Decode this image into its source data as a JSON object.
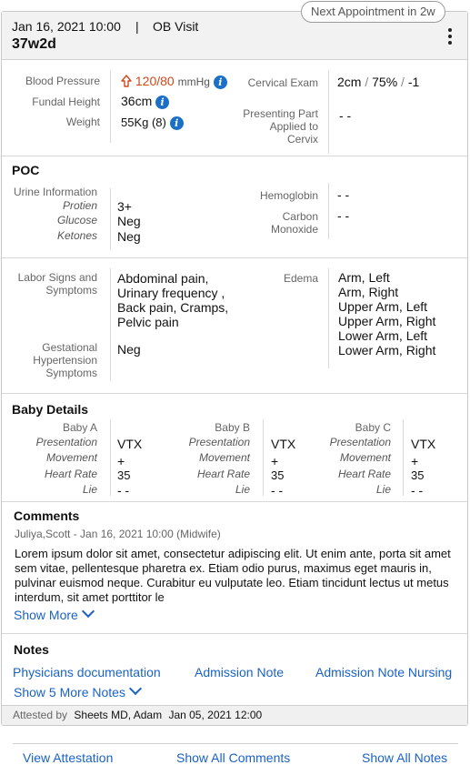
{
  "header": {
    "next_appointment": "Next Appointment in 2w",
    "date": "Jan 16, 2021 10:00",
    "separator": "|",
    "visit_type": "OB Visit",
    "gestational_age": "37w2d"
  },
  "vitals": {
    "blood_pressure_label": "Blood Pressure",
    "blood_pressure_value": "120/80",
    "blood_pressure_unit": "mmHg",
    "fundal_height_label": "Fundal Height",
    "fundal_height_value": "36cm",
    "weight_label": "Weight",
    "weight_value": "55Kg (8)",
    "cervical_exam_label": "Cervical Exam",
    "cervical_exam_dilation": "2cm",
    "cervical_exam_effacement": "75%",
    "cervical_exam_station": "-1",
    "slash": "/",
    "presenting_part_label": "Presenting Part Applied to Cervix",
    "presenting_part_value": "- -",
    "alert_color": "#d0481b"
  },
  "poc": {
    "title": "POC",
    "urine_label": "Urine Information",
    "protein_label": "Protien",
    "protein_value": "3+",
    "glucose_label": "Glucose",
    "glucose_value": "Neg",
    "ketones_label": "Ketones",
    "ketones_value": "Neg",
    "hemoglobin_label": "Hemoglobin",
    "hemoglobin_value": "- -",
    "co_label": "Carbon Monoxide",
    "co_value": "- -"
  },
  "labor": {
    "labor_label": "Labor Signs and Symptoms",
    "labor_values": [
      "Abdominal pain,",
      "Urinary frequency ,",
      "Back pain, Cramps,",
      "Pelvic pain"
    ],
    "gh_label": "Gestational Hypertension Symptoms",
    "gh_value": "Neg",
    "edema_label": "Edema",
    "edema_values": [
      "Arm, Left",
      "Arm, Right",
      "Upper Arm, Left",
      "Upper Arm, Right",
      "Lower Arm, Left",
      "Lower Arm, Right"
    ]
  },
  "baby": {
    "title": "Baby Details",
    "presentation_label": "Presentation",
    "movement_label": "Movement",
    "heart_rate_label": "Heart Rate",
    "lie_label": "Lie",
    "babies": [
      {
        "name": "Baby A",
        "presentation": "VTX",
        "movement": "+",
        "heart_rate": "35",
        "lie": "- -"
      },
      {
        "name": "Baby B",
        "presentation": "VTX",
        "movement": "+",
        "heart_rate": "35",
        "lie": "- -"
      },
      {
        "name": "Baby C",
        "presentation": "VTX",
        "movement": "+",
        "heart_rate": "35",
        "lie": "- -"
      }
    ]
  },
  "comments": {
    "title": "Comments",
    "author_meta": "Juliya,Scott - Jan 16, 2021 10:00 (Midwife)",
    "text": "Lorem ipsum dolor sit amet, consectetur adipiscing elit. Ut enim ante, porta sit amet sem vitae, pellentesque pharetra ex. Etiam odio purus, maximus eget mauris in, pulvinar euismod neque. Curabitur eu vulputate leo. Etiam tincidunt lectus ut metus interdum, sit amet porttitor le",
    "show_more": "Show More"
  },
  "notes": {
    "title": "Notes",
    "links": [
      "Physicians documentation",
      "Admission Note",
      "Admission Note Nursing"
    ],
    "show_more": "Show 5 More Notes"
  },
  "attestation": {
    "label": "Attested by",
    "name": "Sheets MD, Adam",
    "date": "Jan 05, 2021 12:00"
  },
  "actions": {
    "view_attestation": "View Attestation",
    "show_all_comments": "Show All Comments",
    "show_all_notes": "Show All Notes"
  },
  "colors": {
    "link": "#1a62c4",
    "info_icon": "#1a6fc9",
    "header_bg": "#f2f2f2"
  },
  "icons": [
    "kebab-menu-icon",
    "arrow-up-alert-icon",
    "info-icon",
    "chevron-down-icon"
  ]
}
